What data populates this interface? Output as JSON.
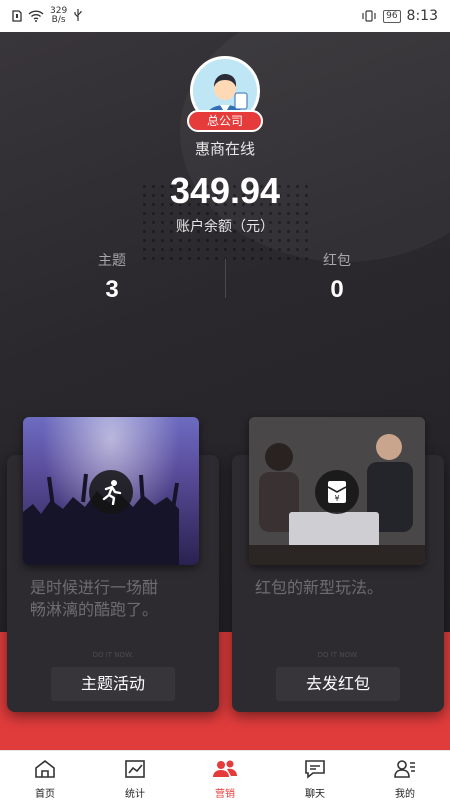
{
  "status_bar": {
    "net_speed_value": "329",
    "net_speed_unit": "B/s",
    "battery": "96",
    "time": "8:13"
  },
  "profile": {
    "badge": "总公司",
    "shop_name": "惠商在线",
    "balance": "349.94",
    "balance_label": "账户余额（元）"
  },
  "stats": [
    {
      "label": "主题",
      "value": "3"
    },
    {
      "label": "红包",
      "value": "0"
    }
  ],
  "cards": [
    {
      "text_line1": "是时候进行一场酣",
      "text_line2": "畅淋漓的酷跑了。",
      "small": "DO IT NOW.",
      "button": "主题活动",
      "icon": "running-person-icon"
    },
    {
      "text_line1": "红包的新型玩法。",
      "text_line2": "",
      "small": "DO IT NOW.",
      "button": "去发红包",
      "icon": "red-packet-icon"
    }
  ],
  "nav": {
    "items": [
      {
        "label": "首页",
        "icon": "home-icon"
      },
      {
        "label": "统计",
        "icon": "chart-icon"
      },
      {
        "label": "营销",
        "icon": "users-icon",
        "active": true
      },
      {
        "label": "聊天",
        "icon": "chat-icon"
      },
      {
        "label": "我的",
        "icon": "profile-icon"
      }
    ]
  },
  "colors": {
    "accent": "#e63b3b",
    "hero_bg": "#2a282c",
    "card_bg": "#2d2b2f"
  }
}
